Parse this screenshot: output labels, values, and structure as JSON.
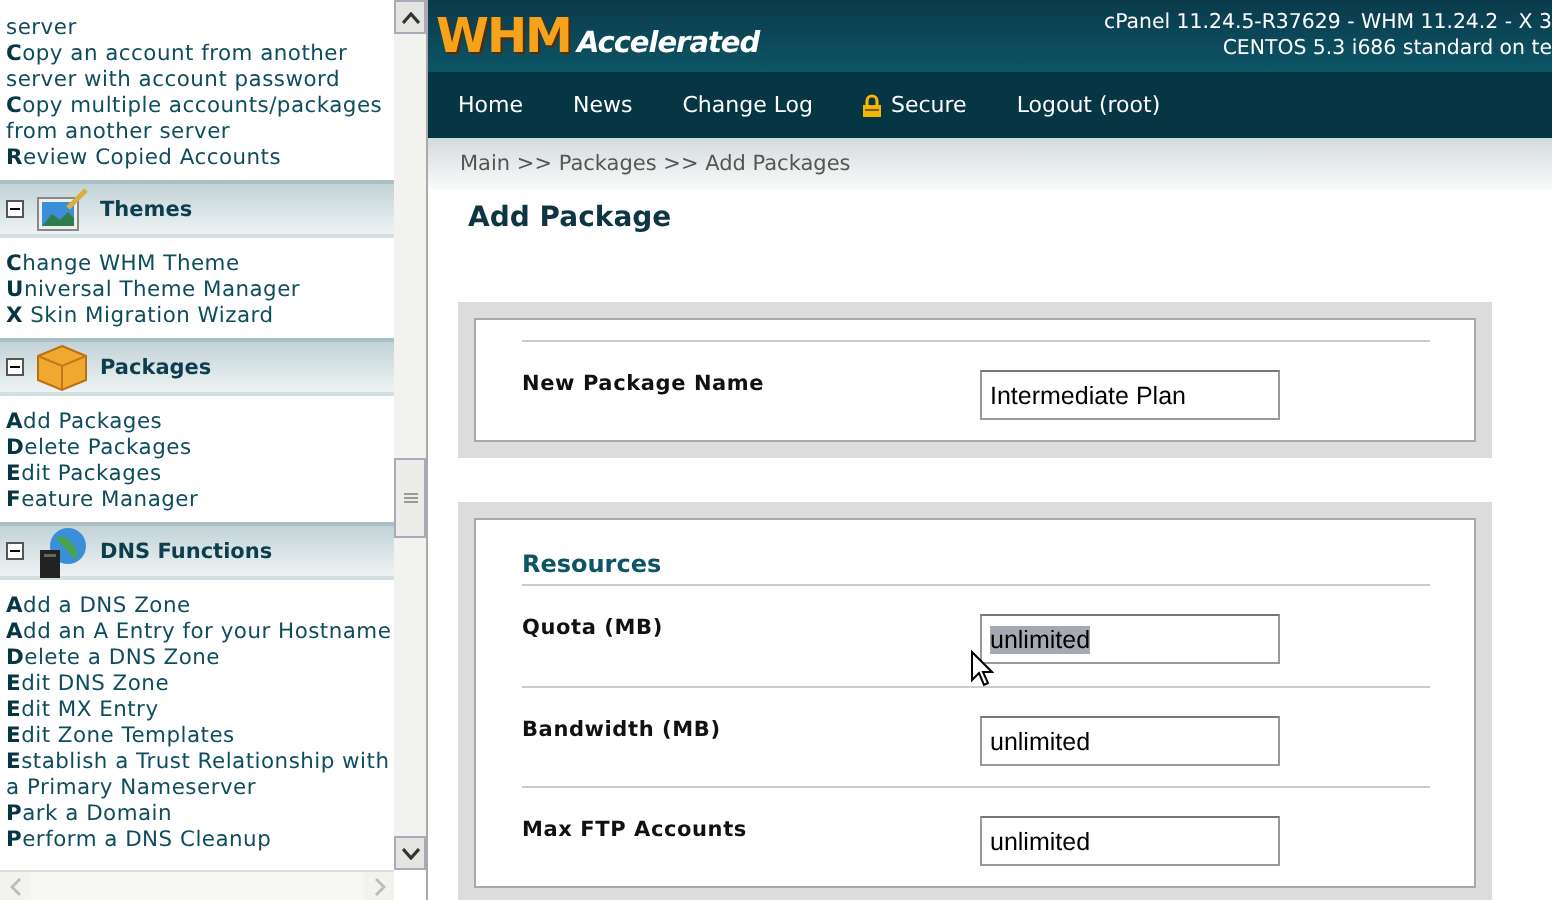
{
  "sidebar": {
    "sections": [
      {
        "items": [
          "server",
          "**C**opy an account from another server with account password",
          "**C**opy multiple accounts/packages from another server",
          "**R**eview Copied Accounts"
        ]
      },
      {
        "title": "Themes",
        "expanded": true,
        "items": [
          "**C**hange WHM Theme",
          "**U**niversal Theme Manager",
          "**X** Skin Migration Wizard"
        ]
      },
      {
        "title": "Packages",
        "expanded": true,
        "items": [
          "**A**dd Packages",
          "**D**elete Packages",
          "**E**dit Packages",
          "**F**eature Manager"
        ]
      },
      {
        "title": "DNS Functions",
        "expanded": true,
        "items": [
          "**A**dd a DNS Zone",
          "**A**dd an A Entry for your Hostname",
          "**D**elete a DNS Zone",
          "**E**dit DNS Zone",
          "**E**dit MX Entry",
          "**E**dit Zone Templates",
          "**E**stablish a Trust Relationship with a Primary Nameserver",
          "**P**ark a Domain",
          "**P**erform a DNS Cleanup"
        ]
      }
    ]
  },
  "header": {
    "logo_mark": "WHM",
    "logo_word": "Accelerated",
    "version": "cPanel 11.24.5-R37629 - WHM 11.24.2 - X 3",
    "system": "CENTOS 5.3 i686 standard on te"
  },
  "nav": [
    {
      "label": "Home",
      "kind": "link"
    },
    {
      "label": "News",
      "kind": "link"
    },
    {
      "label": "Change Log",
      "kind": "link"
    },
    {
      "label": "Secure",
      "kind": "lock"
    },
    {
      "label": "Logout (root)",
      "kind": "link"
    }
  ],
  "breadcrumb": "Main >> Packages >> Add Packages",
  "page_title": "Add Package",
  "panels": [
    {
      "fields": [
        {
          "label": "New Package Name",
          "value": "Intermediate Plan",
          "text_selected": false
        }
      ]
    },
    {
      "heading": "Resources",
      "fields": [
        {
          "label": "Quota (MB)",
          "value": "unlimited",
          "text_selected": true
        },
        {
          "label": "Bandwidth (MB)",
          "value": "unlimited",
          "text_selected": false
        },
        {
          "label": "Max FTP Accounts",
          "value": "unlimited",
          "text_selected": false
        }
      ]
    }
  ]
}
